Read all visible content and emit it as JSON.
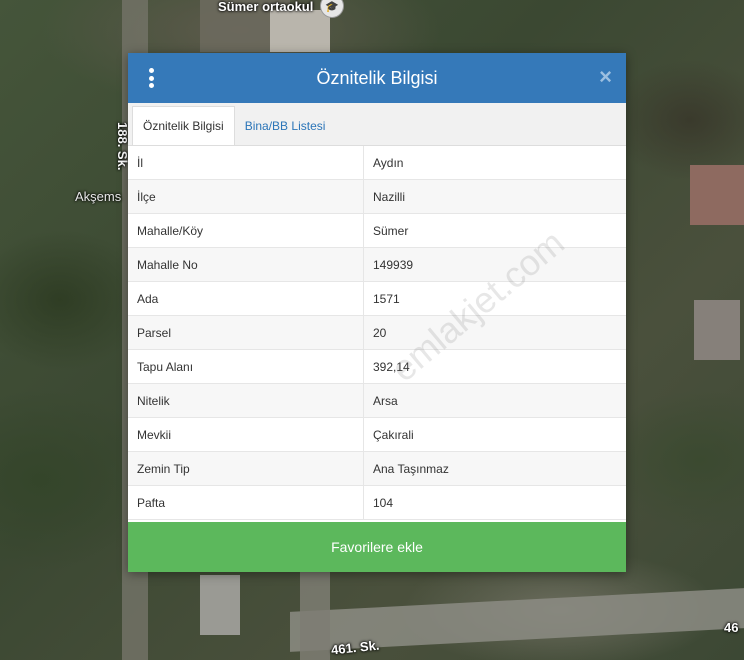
{
  "map": {
    "labels": {
      "school": "Sümer ortaokul",
      "akse": "Akşems",
      "street_188": "188. Sk.",
      "street_461": "461. Sk.",
      "edge_46": "46"
    }
  },
  "modal": {
    "title": "Öznitelik Bilgisi",
    "close_glyph": "×",
    "tabs": [
      {
        "label": "Öznitelik Bilgisi",
        "active": true
      },
      {
        "label": "Bina/BB Listesi",
        "active": false
      }
    ],
    "rows": [
      {
        "key": "İl",
        "value": "Aydın"
      },
      {
        "key": "İlçe",
        "value": "Nazilli"
      },
      {
        "key": "Mahalle/Köy",
        "value": "Sümer"
      },
      {
        "key": "Mahalle No",
        "value": "149939"
      },
      {
        "key": "Ada",
        "value": "1571"
      },
      {
        "key": "Parsel",
        "value": "20"
      },
      {
        "key": "Tapu Alanı",
        "value": "392,14"
      },
      {
        "key": "Nitelik",
        "value": "Arsa"
      },
      {
        "key": "Mevkii",
        "value": "Çakırali"
      },
      {
        "key": "Zemin Tip",
        "value": "Ana Taşınmaz"
      },
      {
        "key": "Pafta",
        "value": "104"
      }
    ],
    "favorite_button": "Favorilere ekle",
    "watermark": "emlakjet.com"
  },
  "colors": {
    "header": "#3579b9",
    "favorite": "#5cb85c",
    "tab_link": "#2b75b8"
  }
}
